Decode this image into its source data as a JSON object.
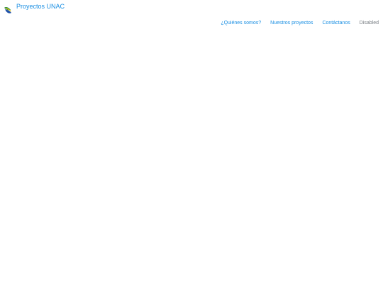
{
  "brand": {
    "title": "Proyectos UNAC",
    "logo_icon": "unac-leaf-logo-icon"
  },
  "nav": {
    "items": [
      {
        "label": "¿Quiénes somos?",
        "enabled": true
      },
      {
        "label": "Nuestros proyectos",
        "enabled": true
      },
      {
        "label": "Contáctanos",
        "enabled": true
      },
      {
        "label": "Disabled",
        "enabled": false
      }
    ]
  },
  "colors": {
    "link": "#1a8fe3",
    "disabled": "#7a7f85",
    "background": "#ffffff"
  }
}
